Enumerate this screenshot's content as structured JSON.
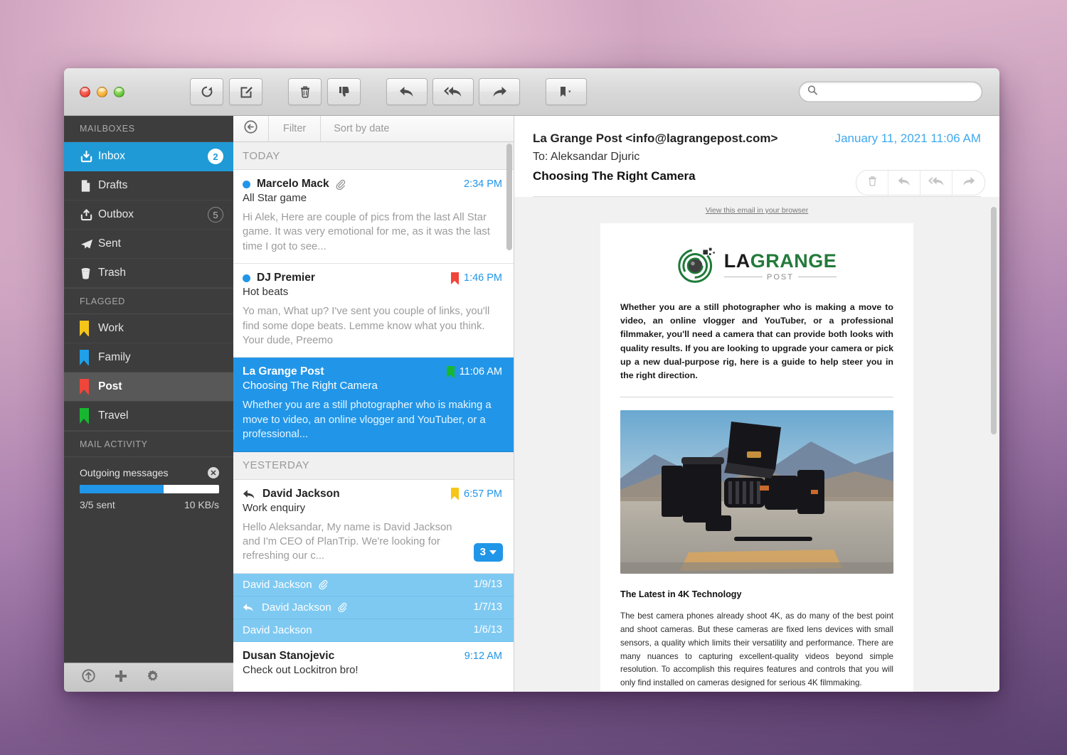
{
  "window": {
    "traffic_lights": [
      "close",
      "minimize",
      "zoom"
    ]
  },
  "toolbar": {
    "buttons": [
      {
        "name": "refresh",
        "label": "Get Mail"
      },
      {
        "name": "compose",
        "label": "Compose New Message"
      },
      {
        "name": "delete",
        "label": "Delete"
      },
      {
        "name": "junk",
        "label": "Mark as Junk"
      },
      {
        "name": "reply",
        "label": "Reply"
      },
      {
        "name": "reply-all",
        "label": "Reply All"
      },
      {
        "name": "forward",
        "label": "Forward"
      },
      {
        "name": "flag",
        "label": "Flag"
      }
    ],
    "search": {
      "value": "",
      "placeholder": ""
    }
  },
  "sidebar": {
    "mailboxes_header": "MAILBOXES",
    "mailboxes": [
      {
        "label": "Inbox",
        "icon": "inbox-icon",
        "count": "2",
        "selected": true
      },
      {
        "label": "Drafts",
        "icon": "drafts-icon",
        "count": ""
      },
      {
        "label": "Outbox",
        "icon": "outbox-icon",
        "count": "5"
      },
      {
        "label": "Sent",
        "icon": "sent-icon",
        "count": ""
      },
      {
        "label": "Trash",
        "icon": "trash-icon",
        "count": ""
      }
    ],
    "flagged_header": "FLAGGED",
    "flagged": [
      {
        "label": "Work",
        "color": "#f5c518",
        "selected": false
      },
      {
        "label": "Family",
        "color": "#1fa0e8",
        "selected": false
      },
      {
        "label": "Post",
        "color": "#f0453a",
        "selected": true
      },
      {
        "label": "Travel",
        "color": "#17b830",
        "selected": false
      }
    ],
    "activity_header": "MAIL ACTIVITY",
    "activity": {
      "title": "Outgoing messages",
      "close": "✕",
      "progress_percent": 60,
      "sent_label": "3/5 sent",
      "rate_label": "10 KB/s"
    },
    "footer_buttons": [
      "get-mail-icon",
      "add-mailbox-icon",
      "settings-gear-icon"
    ]
  },
  "message_list": {
    "toolbar": {
      "back": "back-arrow-icon",
      "filter": "Filter",
      "sort": "Sort by date"
    },
    "sections": [
      {
        "label": "TODAY",
        "messages": [
          {
            "from": "Marcelo Mack",
            "subject": "All Star game",
            "preview": "Hi Alek, Here are couple of pics from the last All Star game. It was very emotional for me, as it was the last time I got to see...",
            "time": "2:34 PM",
            "unread": true,
            "attachment": true,
            "flag_color": "",
            "selected": false
          },
          {
            "from": "DJ Premier",
            "subject": "Hot beats",
            "preview": "Yo man, What up? I've sent you couple of links, you'll find some dope beats. Lemme know what you think. Your dude, Preemo",
            "time": "1:46 PM",
            "unread": true,
            "attachment": false,
            "flag_color": "#f0453a",
            "selected": false
          },
          {
            "from": "La Grange Post",
            "subject": "Choosing The Right Camera",
            "preview": "Whether you are a still photographer who is making a move to video, an online vlogger and YouTuber, or a professional...",
            "time": "11:06 AM",
            "unread": false,
            "attachment": false,
            "flag_color": "#17b830",
            "selected": true
          }
        ]
      },
      {
        "label": "YESTERDAY",
        "messages": [
          {
            "from": "David Jackson",
            "subject": "Work enquiry",
            "preview": "Hello Aleksandar, My name is David Jackson and I'm CEO of PlanTrip. We're looking for refreshing our c...",
            "time": "6:57 PM",
            "unread": false,
            "replied": true,
            "attachment": false,
            "flag_color": "#f5c518",
            "thread_count": "3",
            "selected": false
          }
        ],
        "thread_rows": [
          {
            "from": "David Jackson",
            "date": "1/9/13",
            "attachment": true,
            "replied": false
          },
          {
            "from": "David Jackson",
            "date": "1/7/13",
            "attachment": true,
            "replied": true
          },
          {
            "from": "David Jackson",
            "date": "1/6/13",
            "attachment": false,
            "replied": false
          }
        ],
        "partial_message": {
          "from": "Dusan Stanojevic",
          "time": "9:12 AM",
          "subject": "Check out Lockitron bro!"
        }
      }
    ]
  },
  "reader": {
    "sender": "La Grange Post <info@lagrangepost.com>",
    "date": "January 11, 2021 11:06 AM",
    "to": "To: Aleksandar Djuric",
    "subject": "Choosing The Right Camera",
    "actions": [
      "delete-icon",
      "reply-icon",
      "reply-all-icon",
      "forward-icon"
    ],
    "email": {
      "view_in_browser": "View this email in your browser",
      "logo": {
        "part1": "LA",
        "part2": "GRANGE",
        "sub": "POST"
      },
      "intro": "Whether you are a still photographer who is making a move to video, an online vlogger and YouTuber, or a professional filmmaker, you'll need a camera that can provide both looks with quality results. If you are looking to upgrade your camera or pick up a new dual-purpose rig, here is a guide to help steer you in the right direction.",
      "photo_alt": "cinema-camera-on-road-photo",
      "article_heading": "The Latest in 4K Technology",
      "article_body": "The best camera phones already shoot 4K, as do many of the best point and shoot cameras. But these cameras are fixed lens devices with small sensors, a quality which limits their versatility and performance. There are many nuances to capturing excellent-quality videos beyond simple resolution. To accomplish this requires features and controls that you will only find installed on cameras designed for serious 4K filmmaking."
    }
  },
  "colors": {
    "accent_blue": "#2196e8",
    "sidebar_bg": "#3d3d3d",
    "selected_row": "#2196e8",
    "thread_row": "#7ec9f2",
    "logo_green": "#237a3a"
  }
}
